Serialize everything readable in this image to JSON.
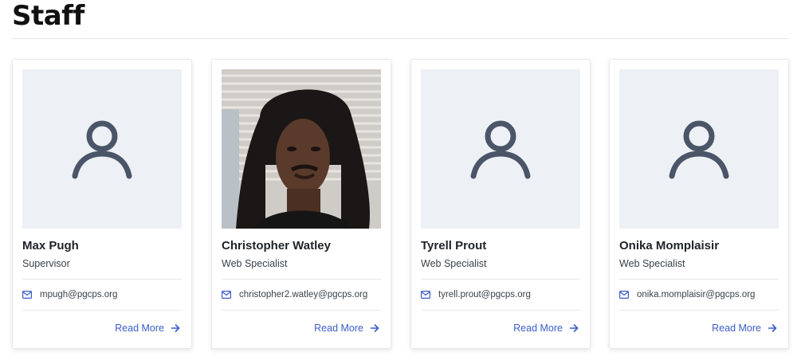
{
  "page": {
    "title": "Staff"
  },
  "cards": [
    {
      "name": "Max Pugh",
      "role": "Supervisor",
      "email": "mpugh@pgcps.org",
      "read_more": "Read More",
      "photo": "placeholder"
    },
    {
      "name": "Christopher Watley",
      "role": "Web Specialist",
      "email": "christopher2.watley@pgcps.org",
      "read_more": "Read More",
      "photo": "portrait"
    },
    {
      "name": "Tyrell Prout",
      "role": "Web Specialist",
      "email": "tyrell.prout@pgcps.org",
      "read_more": "Read More",
      "photo": "placeholder"
    },
    {
      "name": "Onika Momplaisir",
      "role": "Web Specialist",
      "email": "onika.momplaisir@pgcps.org",
      "read_more": "Read More",
      "photo": "placeholder"
    }
  ],
  "icons": {
    "placeholder": "user-icon",
    "email": "mail-icon",
    "read_more": "arrow-right-icon"
  },
  "colors": {
    "link": "#3a5cc8",
    "placeholder_bg": "#edf1f5",
    "placeholder_icon": "#4a5568"
  }
}
